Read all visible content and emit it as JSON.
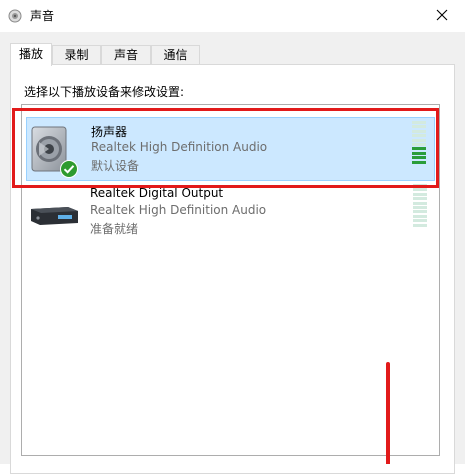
{
  "window": {
    "title": "声音",
    "title_icon": "speaker-icon",
    "close_icon": "close-icon"
  },
  "tabs": [
    {
      "label": "播放",
      "active": true
    },
    {
      "label": "录制",
      "active": false
    },
    {
      "label": "声音",
      "active": false
    },
    {
      "label": "通信",
      "active": false
    }
  ],
  "instruction": "选择以下播放设备来修改设置:",
  "devices": [
    {
      "name": "扬声器",
      "driver": "Realtek High Definition Audio",
      "status": "默认设备",
      "icon": "speaker-device-icon",
      "badge": "default-check-icon",
      "selected": true,
      "level": 0.35
    },
    {
      "name": "Realtek Digital Output",
      "driver": "Realtek High Definition Audio",
      "status": "准备就绪",
      "icon": "digital-output-device-icon",
      "selected": false,
      "level": 0
    }
  ],
  "colors": {
    "selection_bg": "#cce8ff",
    "selection_border": "#99d1ff",
    "annotation_red": "#e21a1a",
    "meter_on": "#2a9d3a",
    "meter_off": "#d3eadf"
  }
}
